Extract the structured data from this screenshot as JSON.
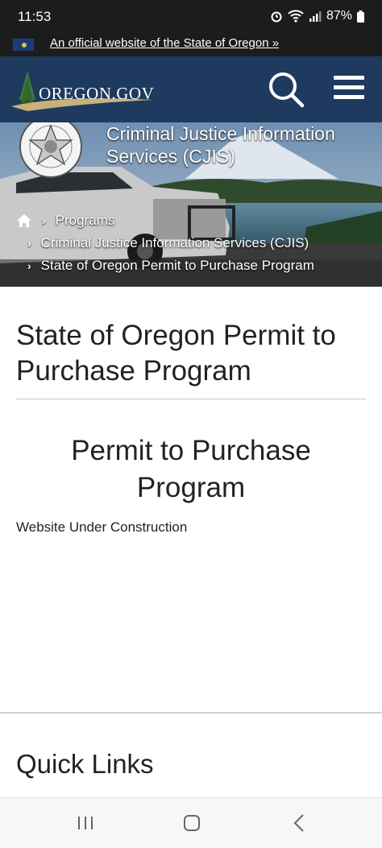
{
  "status_bar": {
    "time": "11:53",
    "battery": "87%"
  },
  "official_banner": {
    "link_text": "An official website of the State of Oregon »"
  },
  "header": {
    "logo_text": "OREGON.GOV",
    "accent_color": "#1f3a5f"
  },
  "hero": {
    "title": "Criminal Justice Information Services (CJIS)",
    "breadcrumb": [
      "Programs",
      "Criminal Justice Information Services (CJIS)",
      "State of Oregon Permit to Purchase Program"
    ]
  },
  "main": {
    "page_title": "State of Oregon Permit to Purchase Program",
    "section_heading": "Permit to Purchase Program",
    "body_text": "Website Under Construction",
    "quick_links_heading": "Quick Links"
  }
}
